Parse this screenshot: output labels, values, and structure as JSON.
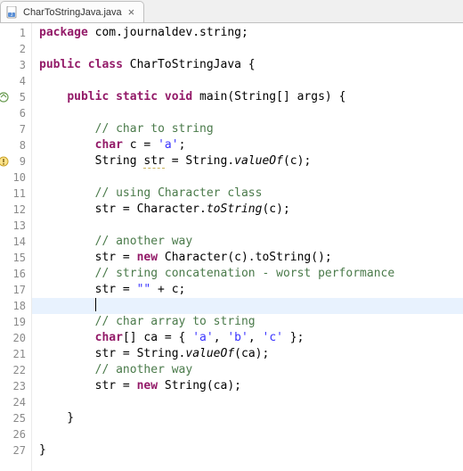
{
  "tab": {
    "filename": "CharToStringJava.java",
    "icon_name": "java-file-icon",
    "close_icon": "close-icon"
  },
  "gutter": {
    "lines": [
      "1",
      "2",
      "3",
      "4",
      "5",
      "6",
      "7",
      "8",
      "9",
      "10",
      "11",
      "12",
      "13",
      "14",
      "15",
      "16",
      "17",
      "18",
      "19",
      "20",
      "21",
      "22",
      "23",
      "24",
      "25",
      "26",
      "27"
    ],
    "markers": {
      "5": "override-marker",
      "9": "warning-marker"
    }
  },
  "code": {
    "lines": [
      [
        {
          "t": "package ",
          "c": "t-keyword"
        },
        {
          "t": "com.journaldev.string;",
          "c": "t-default"
        }
      ],
      [],
      [
        {
          "t": "public class ",
          "c": "t-keyword"
        },
        {
          "t": "CharToStringJava {",
          "c": "t-default"
        }
      ],
      [],
      [
        {
          "t": "    ",
          "c": "t-default"
        },
        {
          "t": "public static void ",
          "c": "t-keyword"
        },
        {
          "t": "main(String[] args) {",
          "c": "t-default"
        }
      ],
      [],
      [
        {
          "t": "        ",
          "c": "t-default"
        },
        {
          "t": "// char to string",
          "c": "t-comment"
        }
      ],
      [
        {
          "t": "        ",
          "c": "t-default"
        },
        {
          "t": "char",
          "c": "t-keyword"
        },
        {
          "t": " c = ",
          "c": "t-default"
        },
        {
          "t": "'a'",
          "c": "t-string"
        },
        {
          "t": ";",
          "c": "t-default"
        }
      ],
      [
        {
          "t": "        String ",
          "c": "t-default"
        },
        {
          "t": "str",
          "c": "squiggle"
        },
        {
          "t": " = String.",
          "c": "t-default"
        },
        {
          "t": "valueOf",
          "c": "t-static"
        },
        {
          "t": "(c);",
          "c": "t-default"
        }
      ],
      [],
      [
        {
          "t": "        ",
          "c": "t-default"
        },
        {
          "t": "// using Character class",
          "c": "t-comment"
        }
      ],
      [
        {
          "t": "        str = Character.",
          "c": "t-default"
        },
        {
          "t": "toString",
          "c": "t-static"
        },
        {
          "t": "(c);",
          "c": "t-default"
        }
      ],
      [],
      [
        {
          "t": "        ",
          "c": "t-default"
        },
        {
          "t": "// another way",
          "c": "t-comment"
        }
      ],
      [
        {
          "t": "        str = ",
          "c": "t-default"
        },
        {
          "t": "new",
          "c": "t-keyword"
        },
        {
          "t": " Character(c).toString();",
          "c": "t-default"
        }
      ],
      [
        {
          "t": "        ",
          "c": "t-default"
        },
        {
          "t": "// string concatenation - worst performance",
          "c": "t-comment"
        }
      ],
      [
        {
          "t": "        str = ",
          "c": "t-default"
        },
        {
          "t": "\"\"",
          "c": "t-string"
        },
        {
          "t": " + c;",
          "c": "t-default"
        }
      ],
      [
        {
          "t": "        ",
          "c": "t-default"
        }
      ],
      [
        {
          "t": "        ",
          "c": "t-default"
        },
        {
          "t": "// char array to string",
          "c": "t-comment"
        }
      ],
      [
        {
          "t": "        ",
          "c": "t-default"
        },
        {
          "t": "char",
          "c": "t-keyword"
        },
        {
          "t": "[] ca = { ",
          "c": "t-default"
        },
        {
          "t": "'a'",
          "c": "t-string"
        },
        {
          "t": ", ",
          "c": "t-default"
        },
        {
          "t": "'b'",
          "c": "t-string"
        },
        {
          "t": ", ",
          "c": "t-default"
        },
        {
          "t": "'c'",
          "c": "t-string"
        },
        {
          "t": " };",
          "c": "t-default"
        }
      ],
      [
        {
          "t": "        str = String.",
          "c": "t-default"
        },
        {
          "t": "valueOf",
          "c": "t-static"
        },
        {
          "t": "(ca);",
          "c": "t-default"
        }
      ],
      [
        {
          "t": "        ",
          "c": "t-default"
        },
        {
          "t": "// another way",
          "c": "t-comment"
        }
      ],
      [
        {
          "t": "        str = ",
          "c": "t-default"
        },
        {
          "t": "new",
          "c": "t-keyword"
        },
        {
          "t": " String(ca);",
          "c": "t-default"
        }
      ],
      [],
      [
        {
          "t": "    }",
          "c": "t-default"
        }
      ],
      [],
      [
        {
          "t": "}",
          "c": "t-default"
        }
      ]
    ],
    "highlighted_line": 18,
    "caret_line": 18
  }
}
